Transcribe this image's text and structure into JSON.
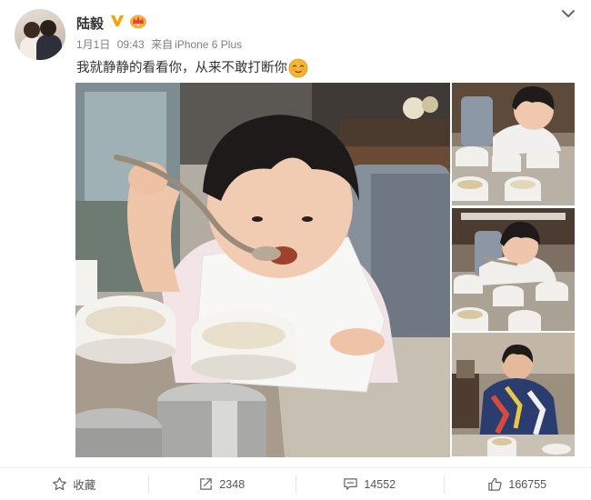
{
  "post": {
    "user": {
      "name": "陆毅",
      "avatar_icon": "avatar-photo",
      "badges": [
        "vip-v-icon",
        "crown-icon"
      ]
    },
    "date": "1月1日",
    "time": "09:43",
    "source_prefix": "来自",
    "source_device": "iPhone 6 Plus",
    "text": "我就静静的看看你，从来不敢打断你",
    "text_emoji_icon": "smile-emoji-icon",
    "images": [
      {
        "name": "main-photo",
        "subject": "child eating porridge with spoon"
      },
      {
        "name": "thumbnail-1",
        "subject": "child at breakfast table"
      },
      {
        "name": "thumbnail-2",
        "subject": "child with spoon and cups"
      },
      {
        "name": "thumbnail-3",
        "subject": "man at breakfast table"
      }
    ],
    "more_icon": "chevron-down-icon"
  },
  "actions": {
    "favorite": {
      "label": "收藏",
      "icon": "star-icon"
    },
    "repost": {
      "count": "2348",
      "icon": "repost-icon"
    },
    "comment": {
      "count": "14552",
      "icon": "comment-icon"
    },
    "like": {
      "count": "166755",
      "icon": "thumbs-up-icon"
    }
  },
  "colors": {
    "vip_badge": "#f3a500",
    "crown": "#f05a3a",
    "meta_text": "#808080",
    "emoji": "#f5b531"
  }
}
